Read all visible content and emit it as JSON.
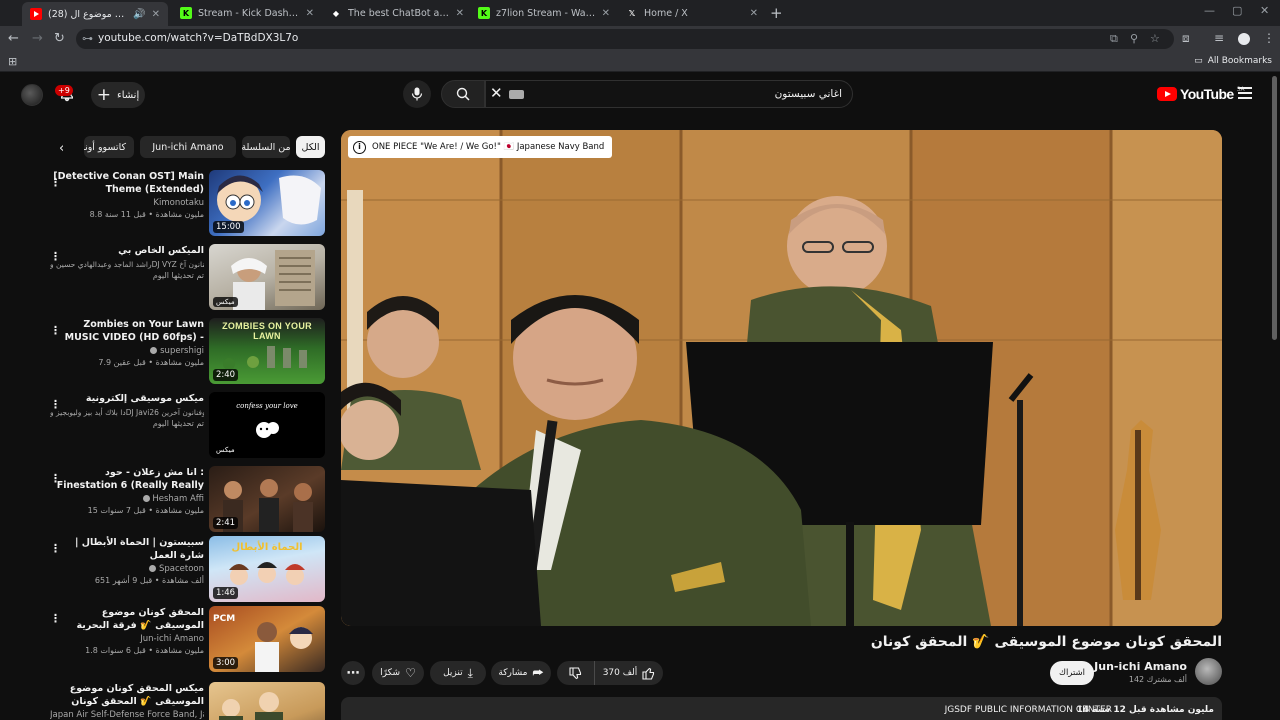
{
  "browser": {
    "tabs": [
      {
        "title": "(28) المحقق كونان موضوع ال",
        "favicon": "youtube",
        "color": "#ff0000",
        "active": true
      },
      {
        "title": "Stream - Kick Dashboard",
        "favicon": "kick",
        "color": "#53fc18",
        "active": false
      },
      {
        "title": "The best ChatBot and Widgets",
        "favicon": "diamond",
        "color": "#ffffff",
        "active": false
      },
      {
        "title": "z7lion Stream - Watch Live on K",
        "favicon": "kick",
        "color": "#53fc18",
        "active": false
      },
      {
        "title": "Home / X",
        "favicon": "x",
        "color": "#ffffff",
        "active": false
      }
    ],
    "url": "youtube.com/watch?v=DaTBdDX3L7o",
    "bookmarks_label": "All Bookmarks"
  },
  "header": {
    "notif_count": "+9",
    "create_label": "إنشاء",
    "search_query": "اغاني سبيستون",
    "logo_text": "YouTube",
    "region": "SA"
  },
  "chips": [
    "الكل",
    "من السلسلة",
    "Jun-ichi Amano",
    "كاتسوو أونو"
  ],
  "recommendations": [
    {
      "title": "[Detective Conan OST] Main Theme (Extended)",
      "channel": "Kimonotaku",
      "meta": "8.8 مليون مشاهدة • قبل 11 سنة",
      "duration": "15:00",
      "thumb": "conan"
    },
    {
      "title": "الميكس الخاص بي",
      "channel": "راشد الماجد وعبدالهادي حسين وDJ VYZ وفنانون آخ...",
      "meta": "تم تحديثها اليوم",
      "duration": "ميكس",
      "thumb": "mix1"
    },
    {
      "title": "Zombies on Your Lawn MUSIC VIDEO (HD 60fps) - Plants vs. ...",
      "channel": "supershigi",
      "meta": "7.9 مليون مشاهدة • قبل عقين",
      "duration": "2:40",
      "thumb": "zombies",
      "thumb_text": "ZOMBIES ON YOUR LAWN"
    },
    {
      "title": "ميكس موسيقى إلكترونية",
      "channel": "دا بلاك أيد بيز وليوبجيز وDJ Javi26 وفنانون آخرين",
      "meta": "تم تحديثها اليوم",
      "duration": "ميكس",
      "thumb": "confess",
      "thumb_text": "confess your love"
    },
    {
      "title": "انا مش زعلان - حود : Finestation 6 (Really Really Haywan Original ...",
      "channel": "Hesham Affi",
      "meta": "15 مليون مشاهدة • قبل 7 سنوات",
      "duration": "2:41",
      "thumb": "mix2"
    },
    {
      "title": "سبيستون | الحماة الأبطال | شارة العمل",
      "channel": "Spacetoon",
      "meta": "651 ألف مشاهدة • قبل 9 أشهر",
      "duration": "1:46",
      "thumb": "spacetoon",
      "thumb_text": "الحماة الأبطال"
    },
    {
      "title": "المحقق كونان موضوع الموسيقى 🎷 فرقة البحرية اليابانية",
      "channel": "Jun-ichi Amano",
      "meta": "1.8 مليون مشاهدة • قبل 6 سنوات",
      "duration": "3:00",
      "thumb": "pcm",
      "thumb_text": "PCM"
    },
    {
      "title": "ميكس المحقق كونان موضوع الموسيقى 🎷 المحقق كونان",
      "channel": "Japan Air Self-Defense Force Band, Ja...",
      "meta": "",
      "duration": "",
      "thumb": "navy"
    }
  ],
  "player": {
    "info_text": "ONE PIECE \"We Are! / We Go!\" 🇯🇵 Japanese Navy Band"
  },
  "video": {
    "title": "المحقق كونان موضوع الموسيقى 🎷 المحقق كونان",
    "channel": "Jun-ichi Amano",
    "subs": "142 ألف مشترك",
    "subscribe_label": "اشتراك",
    "likes": "370 ألف",
    "share_label": "مشاركة",
    "download_label": "تنزيل",
    "thanks_label": "شكرًا",
    "views_line": "14 مليون مشاهدة  قبل 12 سنة",
    "desc_source": "JGSDF PUBLIC INFORMATION CENTER"
  },
  "colors": {
    "accent": "#ff0000",
    "background": "#0f0f0f",
    "chip": "#272727"
  }
}
